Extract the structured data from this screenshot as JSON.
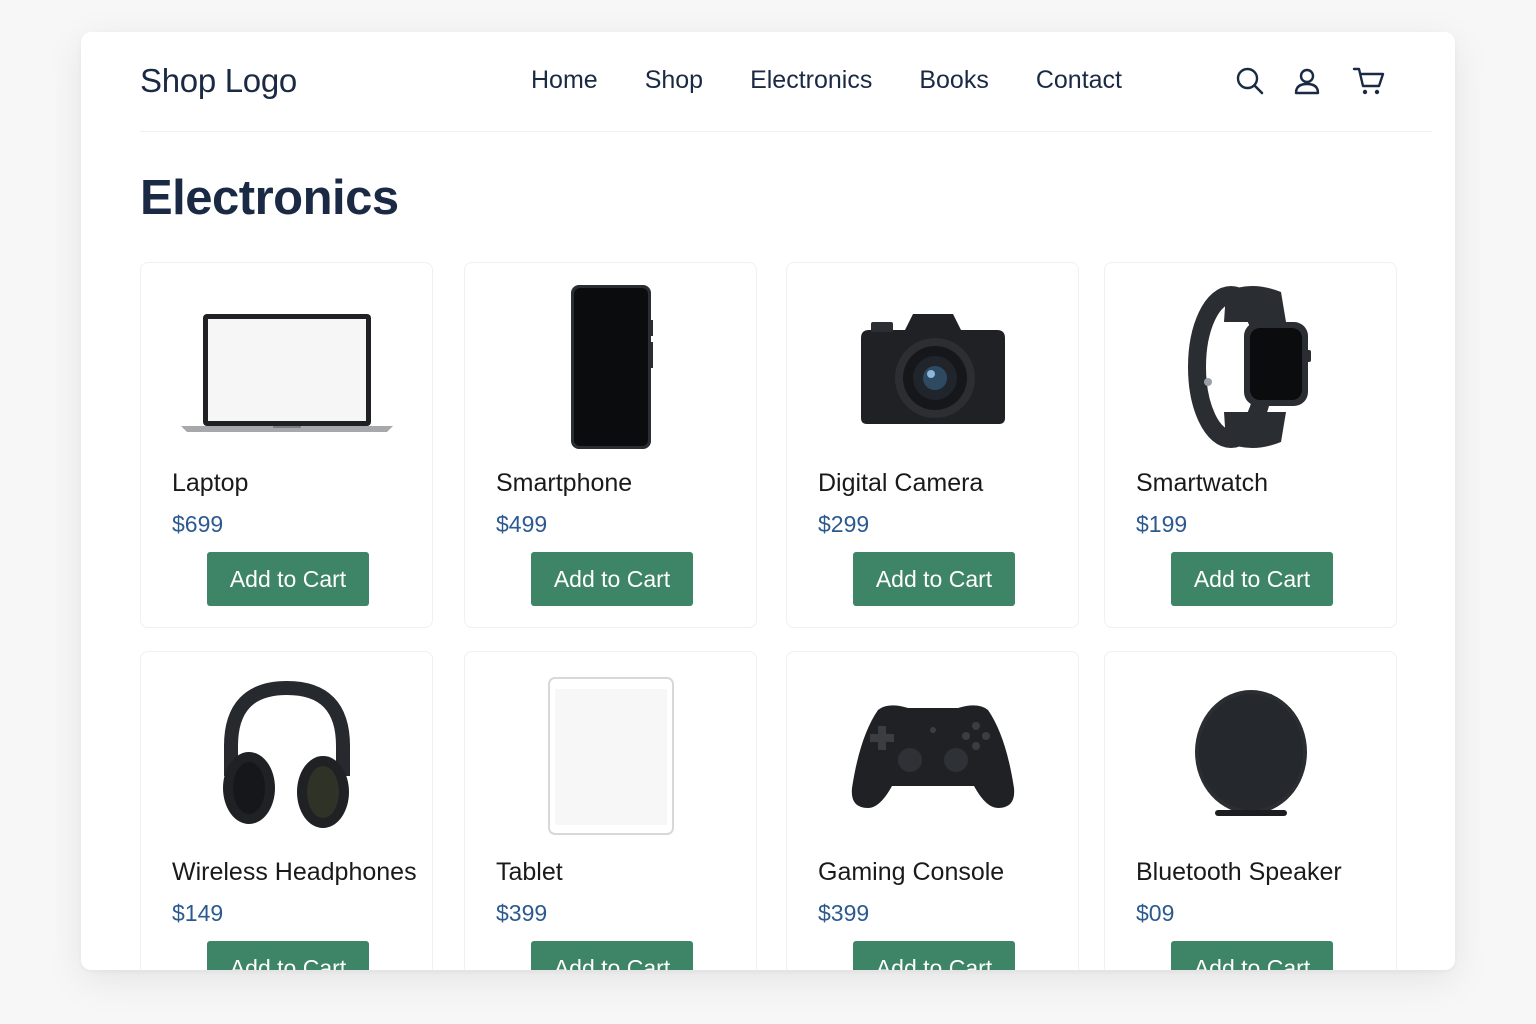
{
  "header": {
    "logo": "Shop Logo",
    "nav": [
      "Home",
      "Shop",
      "Electronics",
      "Books",
      "Contact"
    ],
    "icons": [
      "search-icon",
      "user-icon",
      "cart-icon"
    ]
  },
  "page": {
    "title": "Electronics"
  },
  "products": [
    {
      "name": "Laptop",
      "price": "$699",
      "button": "Add to Cart",
      "image": "laptop-image"
    },
    {
      "name": "Smartphone",
      "price": "$499",
      "button": "Add to Cart",
      "image": "smartphone-image"
    },
    {
      "name": "Digital Camera",
      "price": "$299",
      "button": "Add to Cart",
      "image": "camera-image"
    },
    {
      "name": "Smartwatch",
      "price": "$199",
      "button": "Add to Cart",
      "image": "smartwatch-image"
    },
    {
      "name": "Wireless Headphones",
      "price": "$149",
      "button": "Add to Cart",
      "image": "headphones-image"
    },
    {
      "name": "Tablet",
      "price": "$399",
      "button": "Add to Cart",
      "image": "tablet-image"
    },
    {
      "name": "Gaming Console",
      "price": "$399",
      "button": "Add to Cart",
      "image": "gamepad-image"
    },
    {
      "name": "Bluetooth Speaker",
      "price": "$09",
      "button": "Add to Cart",
      "image": "speaker-image"
    }
  ],
  "colors": {
    "text": "#1b2a44",
    "price": "#2c5a8f",
    "button": "#3d8566",
    "product": "#1f2125"
  }
}
